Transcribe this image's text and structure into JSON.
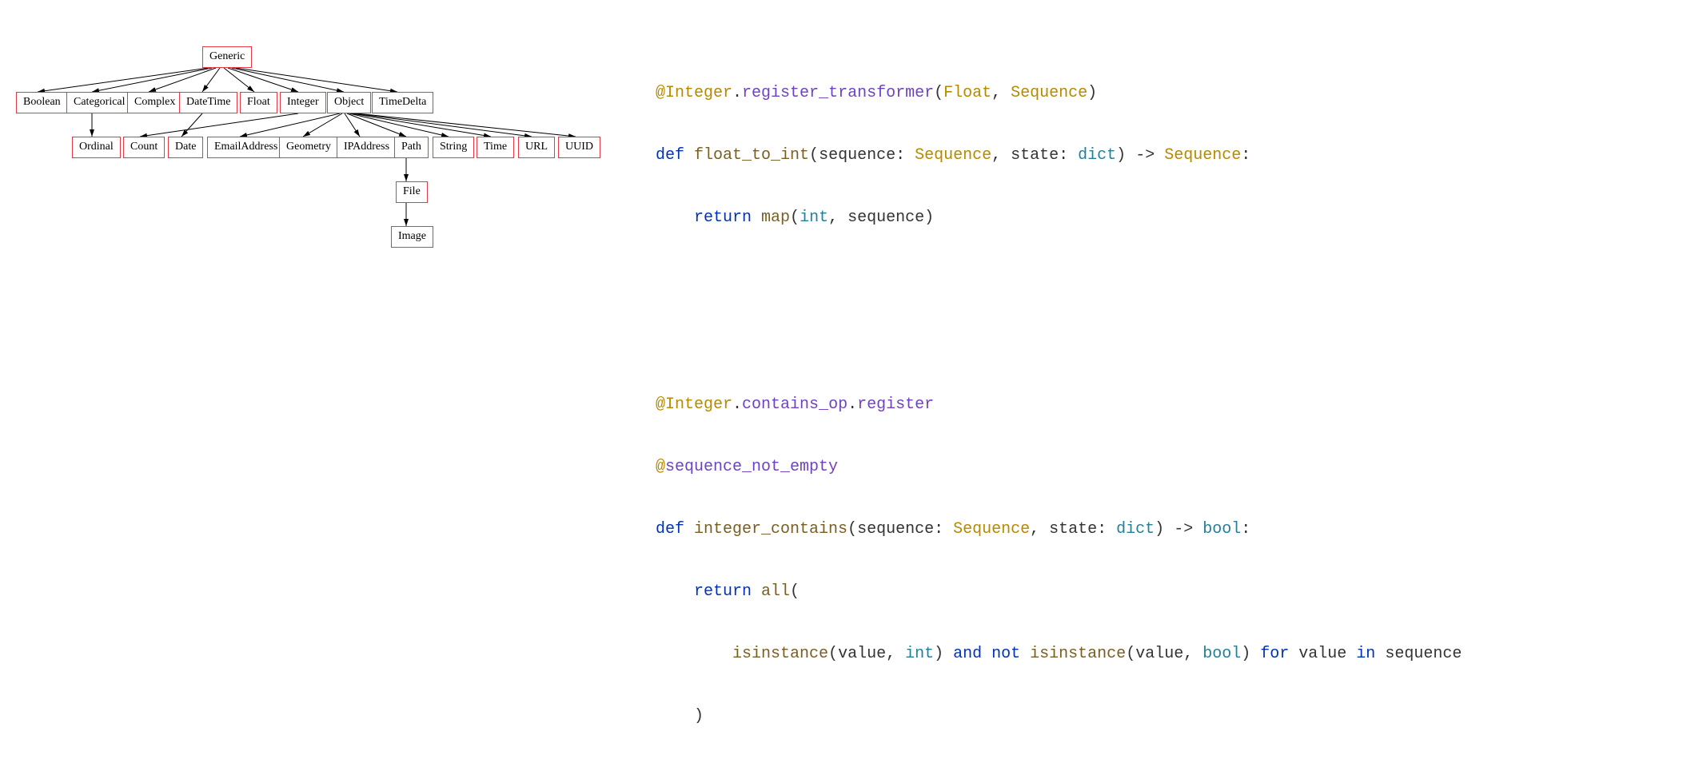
{
  "diagram": {
    "nodes": {
      "generic": "Generic",
      "boolean": "Boolean",
      "categorical": "Categorical",
      "complex": "Complex",
      "datetime": "DateTime",
      "float": "Float",
      "integer": "Integer",
      "object": "Object",
      "timedelta": "TimeDelta",
      "ordinal": "Ordinal",
      "count": "Count",
      "date": "Date",
      "emailaddress": "EmailAddress",
      "geometry": "Geometry",
      "ipaddress": "IPAddress",
      "path": "Path",
      "string": "String",
      "time": "Time",
      "url": "URL",
      "uuid": "UUID",
      "file": "File",
      "image": "Image"
    },
    "edges": [
      [
        "generic",
        "boolean"
      ],
      [
        "generic",
        "categorical"
      ],
      [
        "generic",
        "complex"
      ],
      [
        "generic",
        "datetime"
      ],
      [
        "generic",
        "float"
      ],
      [
        "generic",
        "integer"
      ],
      [
        "generic",
        "object"
      ],
      [
        "generic",
        "timedelta"
      ],
      [
        "categorical",
        "ordinal"
      ],
      [
        "integer",
        "count"
      ],
      [
        "datetime",
        "date"
      ],
      [
        "object",
        "emailaddress"
      ],
      [
        "object",
        "geometry"
      ],
      [
        "object",
        "ipaddress"
      ],
      [
        "object",
        "path"
      ],
      [
        "object",
        "string"
      ],
      [
        "object",
        "time"
      ],
      [
        "object",
        "url"
      ],
      [
        "object",
        "uuid"
      ],
      [
        "path",
        "file"
      ],
      [
        "file",
        "image"
      ]
    ]
  },
  "code": {
    "l1": {
      "at": "@",
      "cls": "Integer",
      "dot1": ".",
      "method": "register_transformer",
      "lp": "(",
      "arg1": "Float",
      "comma": ", ",
      "arg2": "Sequence",
      "rp": ")"
    },
    "l2": {
      "def": "def ",
      "name": "float_to_int",
      "lp": "(",
      "p1": "sequence",
      "colon1": ": ",
      "t1": "Sequence",
      "comma": ", ",
      "p2": "state",
      "colon2": ": ",
      "t2": "dict",
      "rp": ") ",
      "arrow": "-> ",
      "ret": "Sequence",
      "end": ":"
    },
    "l3": {
      "indent": "    ",
      "ret": "return ",
      "fn": "map",
      "lp": "(",
      "a1": "int",
      "comma": ", ",
      "a2": "sequence",
      "rp": ")"
    },
    "l4": {
      "blank": ""
    },
    "l5": {
      "blank": ""
    },
    "l6": {
      "at": "@",
      "cls": "Integer",
      "dot1": ".",
      "attr": "contains_op",
      "dot2": ".",
      "method": "register"
    },
    "l7": {
      "at": "@",
      "name": "sequence_not_empty"
    },
    "l8": {
      "def": "def ",
      "name": "integer_contains",
      "lp": "(",
      "p1": "sequence",
      "colon1": ": ",
      "t1": "Sequence",
      "comma": ", ",
      "p2": "state",
      "colon2": ": ",
      "t2": "dict",
      "rp": ") ",
      "arrow": "-> ",
      "ret": "bool",
      "end": ":"
    },
    "l9": {
      "indent": "    ",
      "ret": "return ",
      "fn": "all",
      "lp": "("
    },
    "l10": {
      "indent": "        ",
      "fn1": "isinstance",
      "lp1": "(",
      "a1": "value",
      "c1": ", ",
      "a2": "int",
      "rp1": ") ",
      "and": "and ",
      "not": "not ",
      "fn2": "isinstance",
      "lp2": "(",
      "a3": "value",
      "c2": ", ",
      "a4": "bool",
      "rp2": ") ",
      "for": "for ",
      "v": "value ",
      "in": "in ",
      "seq": "sequence"
    },
    "l11": {
      "indent": "    ",
      "rp": ")"
    }
  }
}
